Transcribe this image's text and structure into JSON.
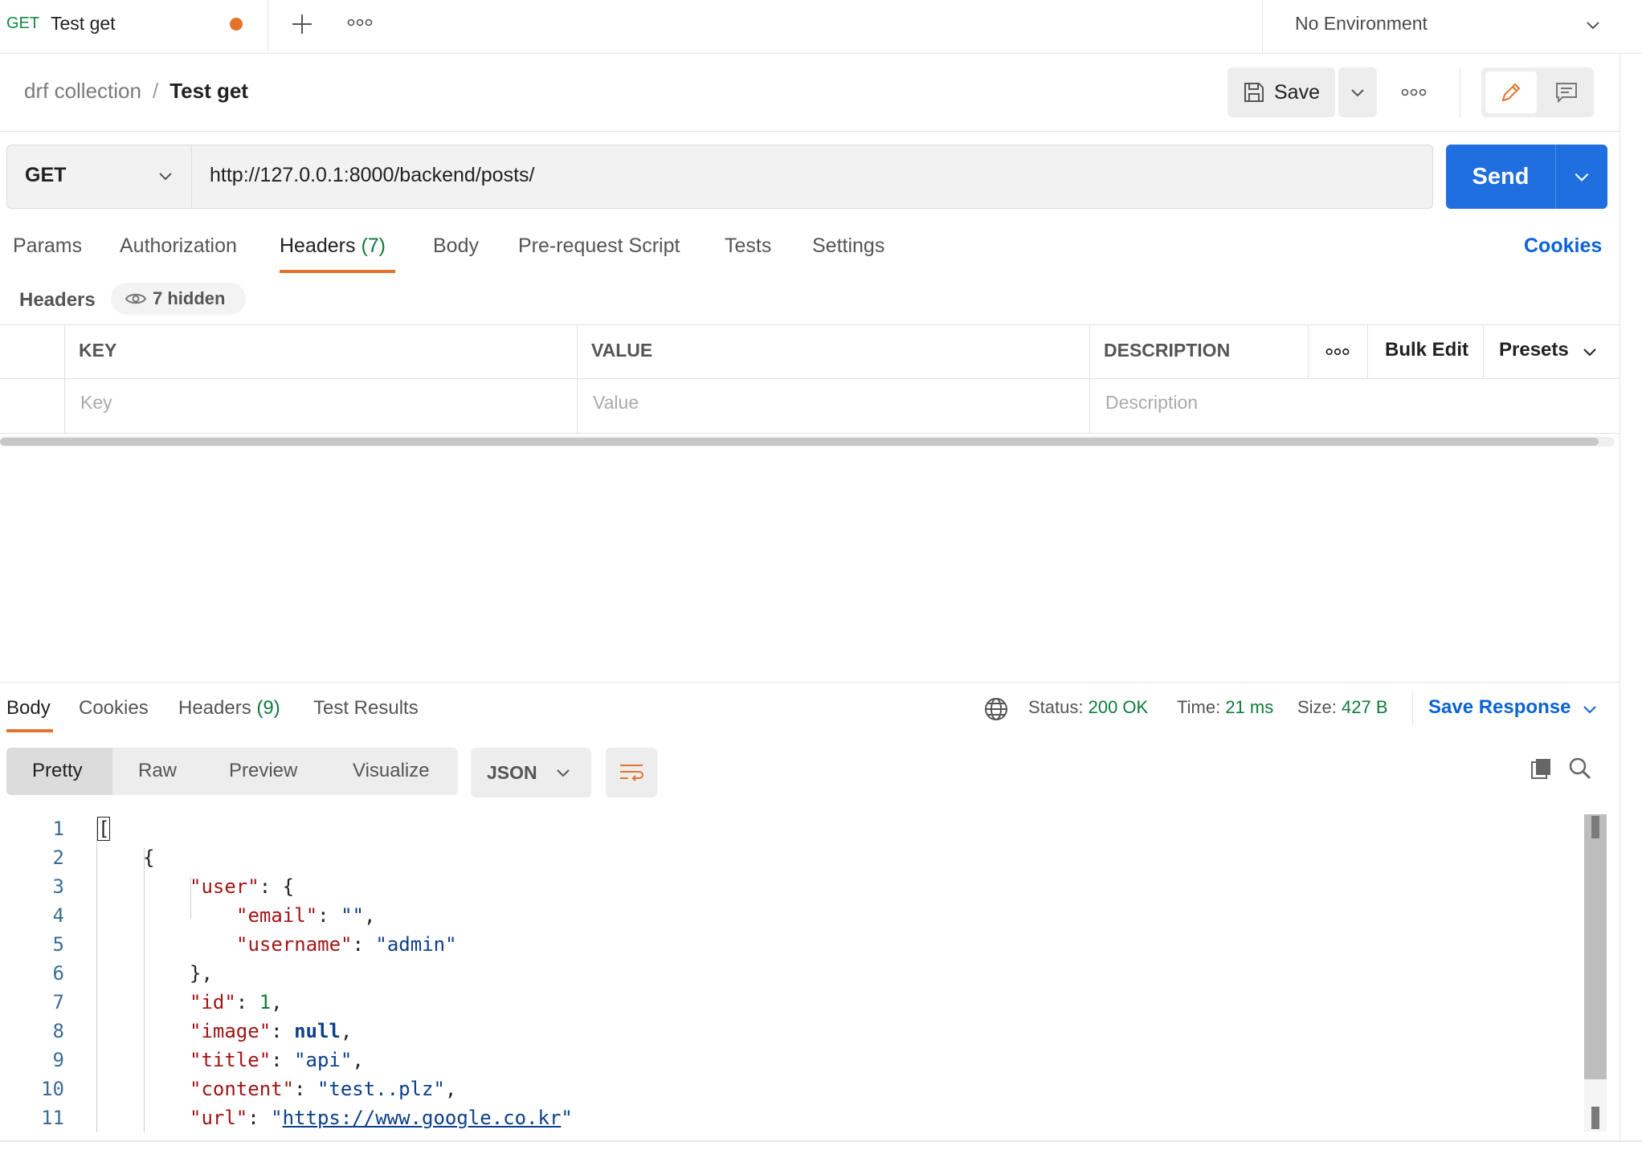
{
  "tab": {
    "method": "GET",
    "name": "Test get"
  },
  "environment": {
    "label": "No Environment"
  },
  "breadcrumb": {
    "collection": "drf collection",
    "separator": "/",
    "current": "Test get"
  },
  "toolbar": {
    "save_label": "Save"
  },
  "request": {
    "method": "GET",
    "url": "http://127.0.0.1:8000/backend/posts/",
    "send_label": "Send"
  },
  "request_tabs": {
    "params": "Params",
    "authorization": "Authorization",
    "headers": "Headers",
    "headers_count": "(7)",
    "body": "Body",
    "prerequest": "Pre-request Script",
    "tests": "Tests",
    "settings": "Settings",
    "cookies": "Cookies"
  },
  "headers_section": {
    "label": "Headers",
    "hidden": "7 hidden",
    "columns": {
      "key": "KEY",
      "value": "VALUE",
      "description": "DESCRIPTION"
    },
    "placeholders": {
      "key": "Key",
      "value": "Value",
      "description": "Description"
    },
    "bulk_edit": "Bulk Edit",
    "presets": "Presets"
  },
  "response_tabs": {
    "body": "Body",
    "cookies": "Cookies",
    "headers": "Headers",
    "headers_count": "(9)",
    "test_results": "Test Results"
  },
  "response_status": {
    "status_label": "Status:",
    "status_value": "200 OK",
    "time_label": "Time:",
    "time_value": "21 ms",
    "size_label": "Size:",
    "size_value": "427 B",
    "save_response": "Save Response"
  },
  "view_modes": {
    "pretty": "Pretty",
    "raw": "Raw",
    "preview": "Preview",
    "visualize": "Visualize"
  },
  "format": "JSON",
  "code_lines": [
    {
      "n": "1",
      "text": "["
    },
    {
      "n": "2",
      "text": "{"
    },
    {
      "n": "3",
      "key": "\"user\"",
      "rest": ": {"
    },
    {
      "n": "4",
      "key": "\"email\"",
      "value": "\"\"",
      "tail": ","
    },
    {
      "n": "5",
      "key": "\"username\"",
      "value": "\"admin\"",
      "tail": ""
    },
    {
      "n": "6",
      "text": "},"
    },
    {
      "n": "7",
      "key": "\"id\"",
      "value": "1",
      "tail": ","
    },
    {
      "n": "8",
      "key": "\"image\"",
      "value": "null",
      "tail": ","
    },
    {
      "n": "9",
      "key": "\"title\"",
      "value": "\"api\"",
      "tail": ","
    },
    {
      "n": "10",
      "key": "\"content\"",
      "value": "\"test..plz\"",
      "tail": ","
    },
    {
      "n": "11",
      "key": "\"url\"",
      "value": "https://www.google.co.kr",
      "tail": ""
    }
  ]
}
